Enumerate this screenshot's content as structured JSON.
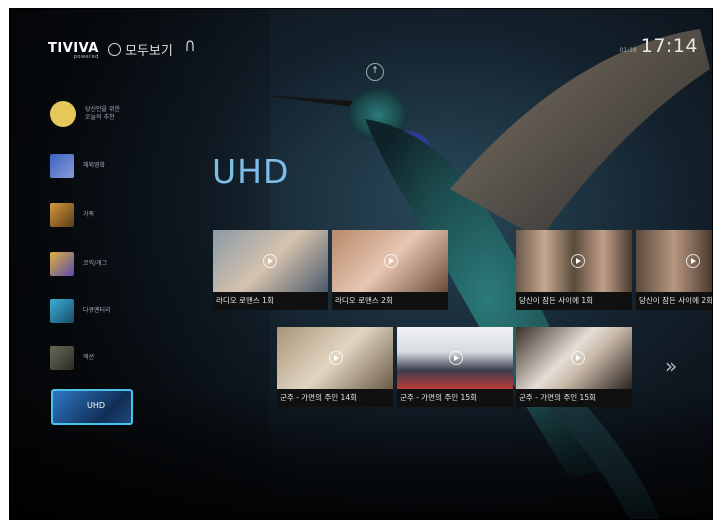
{
  "header": {
    "logo": "TIVIVA",
    "logo_sub": "powered",
    "all_view": "모두보기",
    "time_small": "01:18",
    "time": "17:14"
  },
  "sidebar": {
    "items": [
      {
        "label_line1": "당신만을 위한",
        "label_line2": "오늘의 추천"
      },
      {
        "label_line1": "해외영화",
        "label_line2": ""
      },
      {
        "label_line1": "가족",
        "label_line2": ""
      },
      {
        "label_line1": "코믹/개그",
        "label_line2": ""
      },
      {
        "label_line1": "다큐멘터리",
        "label_line2": ""
      },
      {
        "label_line1": "액션",
        "label_line2": ""
      }
    ],
    "active_label": "UHD"
  },
  "section": {
    "title": "UHD"
  },
  "row1": [
    {
      "title": "라디오 로맨스 1회"
    },
    {
      "title": "라디오 로맨스 2회"
    },
    {
      "title": "당신이 잠든 사이에 1회"
    },
    {
      "title": "당신이 잠든 사이에 2회"
    }
  ],
  "row2": [
    {
      "title": "군주 - 가면의 주인 14회"
    },
    {
      "title": "군주 - 가면의 주인 15회"
    },
    {
      "title": "군주 - 가면의 주인 15회"
    }
  ],
  "colors": {
    "accent": "#49c4e8",
    "title": "#7dbde8"
  },
  "icons": {
    "all": "menu-circle-icon",
    "user": "user-icon",
    "up": "up-arrow-icon",
    "next": "double-chevron-right-icon"
  }
}
